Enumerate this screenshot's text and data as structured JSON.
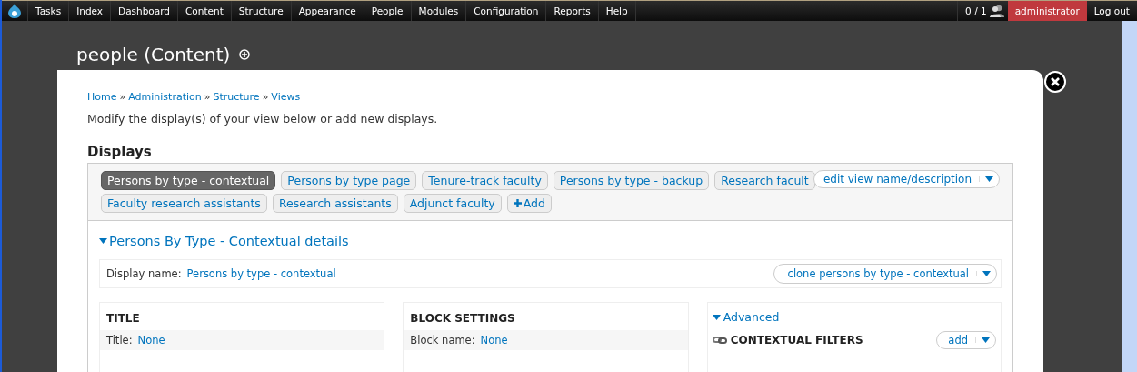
{
  "toolbar": {
    "menu": [
      "Tasks",
      "Index",
      "Dashboard",
      "Content",
      "Structure",
      "Appearance",
      "People",
      "Modules",
      "Configuration",
      "Reports",
      "Help"
    ],
    "counter": "0 / 1",
    "user": "administrator",
    "logout": "Log out"
  },
  "page": {
    "title": "people (Content)"
  },
  "modal": {
    "breadcrumb": [
      "Home",
      "Administration",
      "Structure",
      "Views"
    ],
    "breadcrumb_separator": "»",
    "description": "Modify the display(s) of your view below or add new displays.",
    "displays_heading": "Displays",
    "displays": [
      {
        "label": "Persons by type - contextual",
        "selected": true
      },
      {
        "label": "Persons by type page",
        "selected": false
      },
      {
        "label": "Tenure-track faculty",
        "selected": false
      },
      {
        "label": "Persons by type - backup",
        "selected": false
      },
      {
        "label": "Research facult",
        "selected": false
      },
      {
        "label": "Faculty research assistants",
        "selected": false
      },
      {
        "label": "Research assistants",
        "selected": false
      },
      {
        "label": "Adjunct faculty",
        "selected": false
      }
    ],
    "add_display": "Add",
    "edit_view": "edit view name/description",
    "details": {
      "heading": "Persons By Type - Contextual details",
      "expanded": true,
      "display_name_label": "Display name:",
      "display_name": "Persons by type - contextual",
      "clone": "clone persons by type - contextual"
    },
    "columns": [
      {
        "heading": "TITLE",
        "label": "Title:",
        "value": "None"
      },
      {
        "heading": "BLOCK SETTINGS",
        "label": "Block name:",
        "value": "None"
      }
    ],
    "advanced": {
      "label": "Advanced",
      "expanded": true,
      "filters_heading": "CONTEXTUAL FILTERS",
      "add": "add"
    }
  }
}
